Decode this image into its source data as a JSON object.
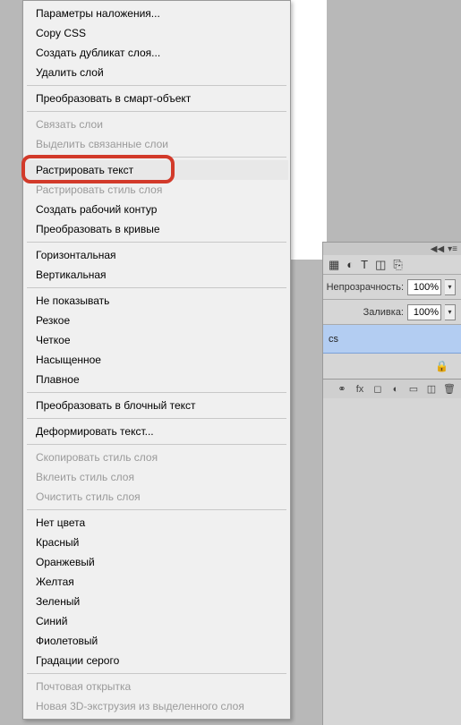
{
  "menu": {
    "groups": [
      [
        {
          "label": "Параметры наложения...",
          "enabled": true
        },
        {
          "label": "Copy CSS",
          "enabled": true
        },
        {
          "label": "Создать дубликат слоя...",
          "enabled": true
        },
        {
          "label": "Удалить слой",
          "enabled": true
        }
      ],
      [
        {
          "label": "Преобразовать в смарт-объект",
          "enabled": true
        }
      ],
      [
        {
          "label": "Связать слои",
          "enabled": false
        },
        {
          "label": "Выделить связанные слои",
          "enabled": false
        }
      ],
      [
        {
          "label": "Растрировать текст",
          "enabled": true,
          "highlighted": true,
          "hover": true
        },
        {
          "label": "Растрировать стиль слоя",
          "enabled": false
        },
        {
          "label": "Создать рабочий контур",
          "enabled": true
        },
        {
          "label": "Преобразовать в кривые",
          "enabled": true
        }
      ],
      [
        {
          "label": "Горизонтальная",
          "enabled": true
        },
        {
          "label": "Вертикальная",
          "enabled": true
        }
      ],
      [
        {
          "label": "Не показывать",
          "enabled": true
        },
        {
          "label": "Резкое",
          "enabled": true
        },
        {
          "label": "Четкое",
          "enabled": true
        },
        {
          "label": "Насыщенное",
          "enabled": true
        },
        {
          "label": "Плавное",
          "enabled": true
        }
      ],
      [
        {
          "label": "Преобразовать в блочный текст",
          "enabled": true
        }
      ],
      [
        {
          "label": "Деформировать текст...",
          "enabled": true
        }
      ],
      [
        {
          "label": "Скопировать стиль слоя",
          "enabled": false
        },
        {
          "label": "Вклеить стиль слоя",
          "enabled": false
        },
        {
          "label": "Очистить стиль слоя",
          "enabled": false
        }
      ],
      [
        {
          "label": "Нет цвета",
          "enabled": true
        },
        {
          "label": "Красный",
          "enabled": true
        },
        {
          "label": "Оранжевый",
          "enabled": true
        },
        {
          "label": "Желтая",
          "enabled": true
        },
        {
          "label": "Зеленый",
          "enabled": true
        },
        {
          "label": "Синий",
          "enabled": true
        },
        {
          "label": "Фиолетовый",
          "enabled": true
        },
        {
          "label": "Градации серого",
          "enabled": true
        }
      ],
      [
        {
          "label": "Почтовая открытка",
          "enabled": false
        },
        {
          "label": "Новая 3D-экструзия из выделенного слоя",
          "enabled": false
        }
      ]
    ]
  },
  "panel": {
    "opacity_label": "Непрозрачность:",
    "opacity_value": "100%",
    "fill_label": "Заливка:",
    "fill_value": "100%",
    "layer_name": "cs",
    "toolbar_icons": [
      "image-icon",
      "adjust-icon",
      "type-icon",
      "transform-icon",
      "link-icon"
    ],
    "bottom_icons": [
      "link-icon",
      "fx-icon",
      "mask-icon",
      "adjust-icon",
      "group-icon",
      "new-icon",
      "trash-icon"
    ]
  }
}
